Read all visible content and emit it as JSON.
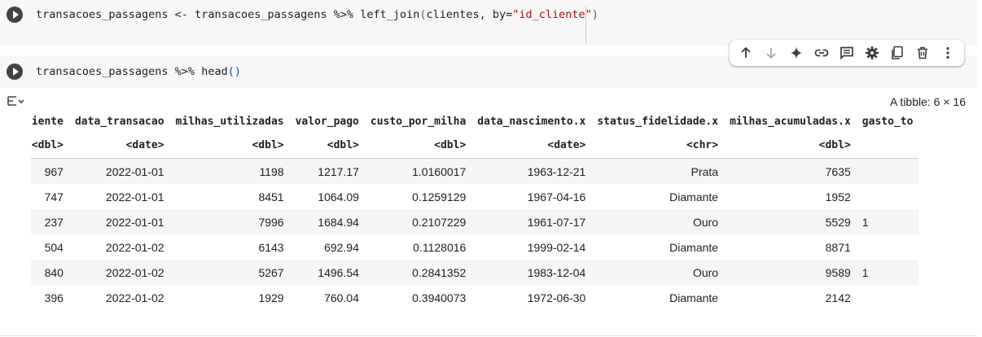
{
  "cells": [
    {
      "code_parts": [
        "transacoes_passagens <- transacoes_passagens %>% left_join",
        "(",
        "clientes, by=",
        "\"id_cliente\"",
        ")"
      ]
    },
    {
      "code_parts": [
        "transacoes_passagens %>% head",
        "()"
      ]
    }
  ],
  "toolbar": {
    "icons": [
      "arrow-up-icon",
      "arrow-down-icon",
      "sparkle-icon",
      "link-icon",
      "comment-icon",
      "gear-icon",
      "mirror-cell-icon",
      "trash-icon",
      "more-vert-icon"
    ]
  },
  "output": {
    "tibble_label": "A tibble: 6 × 16",
    "columns": [
      "liente",
      "data_transacao",
      "milhas_utilizadas",
      "valor_pago",
      "custo_por_milha",
      "data_nascimento.x",
      "status_fidelidade.x",
      "milhas_acumuladas.x",
      "gasto_to"
    ],
    "types": [
      "<dbl>",
      "<date>",
      "<dbl>",
      "<dbl>",
      "<dbl>",
      "<date>",
      "<chr>",
      "<dbl>",
      ""
    ],
    "rows": [
      [
        "967",
        "2022-01-01",
        "1198",
        "1217.17",
        "1.0160017",
        "1963-12-21",
        "Prata",
        "7635",
        ""
      ],
      [
        "747",
        "2022-01-01",
        "8451",
        "1064.09",
        "0.1259129",
        "1967-04-16",
        "Diamante",
        "1952",
        ""
      ],
      [
        "237",
        "2022-01-01",
        "7996",
        "1684.94",
        "0.2107229",
        "1961-07-17",
        "Ouro",
        "5529",
        "1"
      ],
      [
        "504",
        "2022-01-02",
        "6143",
        "692.94",
        "0.1128016",
        "1999-02-14",
        "Diamante",
        "8871",
        ""
      ],
      [
        "840",
        "2022-01-02",
        "5267",
        "1496.54",
        "0.2841352",
        "1983-12-04",
        "Ouro",
        "9589",
        "1"
      ],
      [
        "396",
        "2022-01-02",
        "1929",
        "760.04",
        "0.3940073",
        "1972-06-30",
        "Diamante",
        "2142",
        ""
      ]
    ]
  }
}
